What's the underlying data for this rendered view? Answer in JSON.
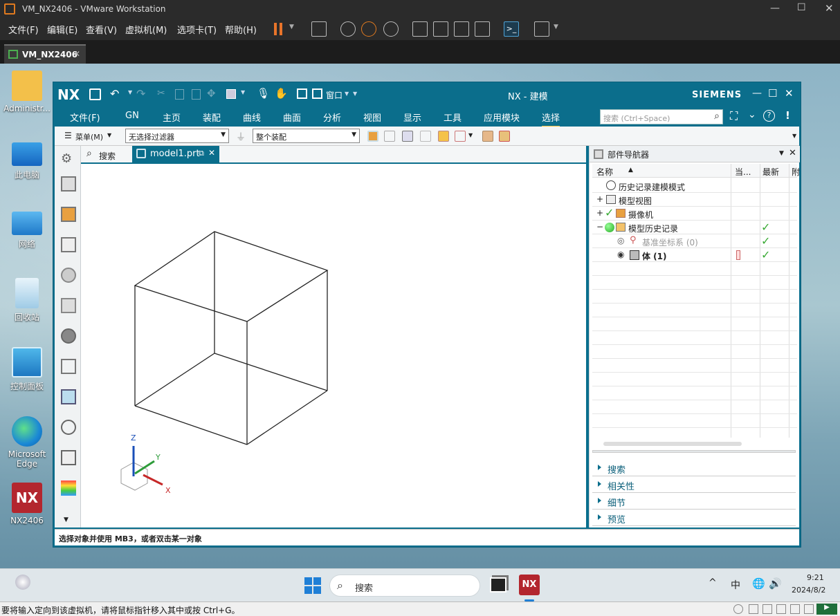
{
  "vmware": {
    "title": "VM_NX2406 - VMware Workstation",
    "menu": [
      "文件(F)",
      "编辑(E)",
      "查看(V)",
      "虚拟机(M)",
      "选项卡(T)",
      "帮助(H)"
    ],
    "tab_label": "VM_NX2406",
    "status_text": "要将输入定向到该虚拟机，请将鼠标指针移入其中或按 Ctrl+G。"
  },
  "desktop": {
    "icons": [
      "Administr...",
      "此电脑",
      "网络",
      "回收站",
      "控制面板",
      "Microsoft Edge",
      "NX2406"
    ]
  },
  "taskbar": {
    "search_placeholder": "搜索",
    "ime": "中",
    "time": "9:21",
    "date": "2024/8/2"
  },
  "nx": {
    "logo": "NX",
    "title": "NX - 建模",
    "brand": "SIEMENS",
    "window_menu_label": "窗口",
    "menu": [
      "文件(F)",
      "GN",
      "主页",
      "装配",
      "曲线",
      "曲面",
      "分析",
      "视图",
      "显示",
      "工具",
      "应用模块",
      "选择"
    ],
    "selected_menu": "选择",
    "search_placeholder": "搜索 (Ctrl+Space)",
    "toolbar": {
      "menu_label": "菜单(M)",
      "filter_value": "无选择过滤器",
      "assembly_value": "整个装配"
    },
    "graphics_tabs": {
      "search_label": "搜索",
      "model_label": "model1.prt"
    },
    "axes": {
      "z": "Z",
      "y": "Y",
      "x": "X"
    },
    "part_navigator": {
      "title": "部件导航器",
      "columns": [
        "名称",
        "当...",
        "最新",
        "附"
      ],
      "rows": [
        {
          "label": "历史记录建模模式",
          "latest": ""
        },
        {
          "label": "模型视图",
          "latest": ""
        },
        {
          "label": "摄像机",
          "latest": ""
        },
        {
          "label": "模型历史记录",
          "latest": "✓"
        },
        {
          "label": "基准坐标系 (0)",
          "latest": "✓"
        },
        {
          "label": "体 (1)",
          "latest": "✓"
        }
      ],
      "sections": [
        "搜索",
        "相关性",
        "细节",
        "预览"
      ]
    },
    "status_text": "选择对象并使用 MB3，或者双击某一对象"
  },
  "colors": {
    "nx_teal": "#0b6e8c",
    "check_green": "#3aaa35",
    "accent_yellow": "#f6c344"
  }
}
